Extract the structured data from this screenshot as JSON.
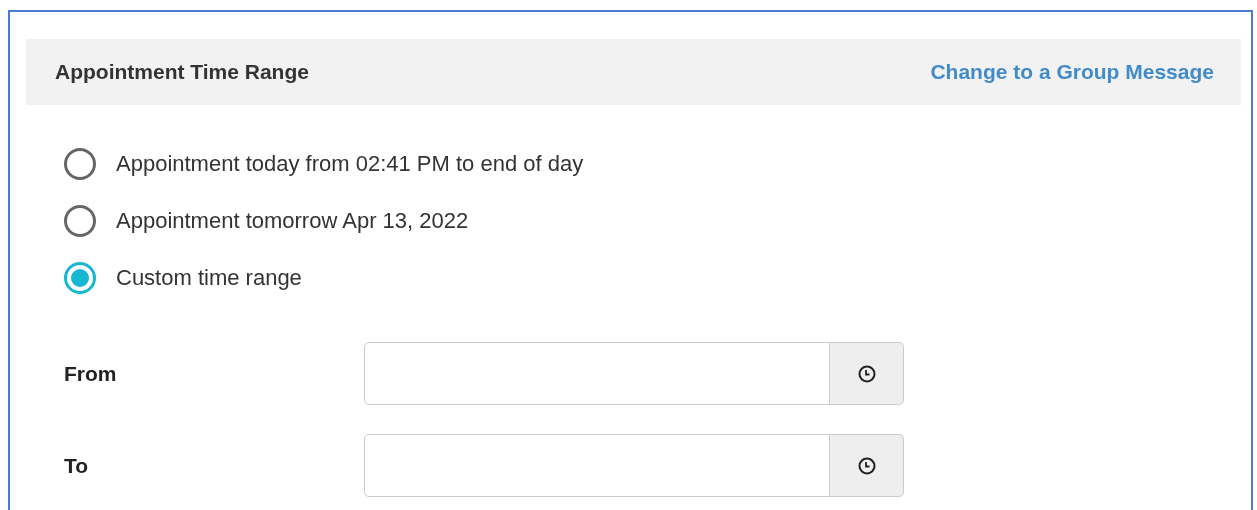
{
  "header": {
    "title": "Appointment Time Range",
    "link": "Change to a Group Message"
  },
  "options": [
    {
      "label": "Appointment today from 02:41 PM to end of day",
      "selected": false
    },
    {
      "label": "Appointment tomorrow Apr 13, 2022",
      "selected": false
    },
    {
      "label": "Custom time range",
      "selected": true
    }
  ],
  "fields": [
    {
      "label": "From"
    },
    {
      "label": "To"
    }
  ]
}
